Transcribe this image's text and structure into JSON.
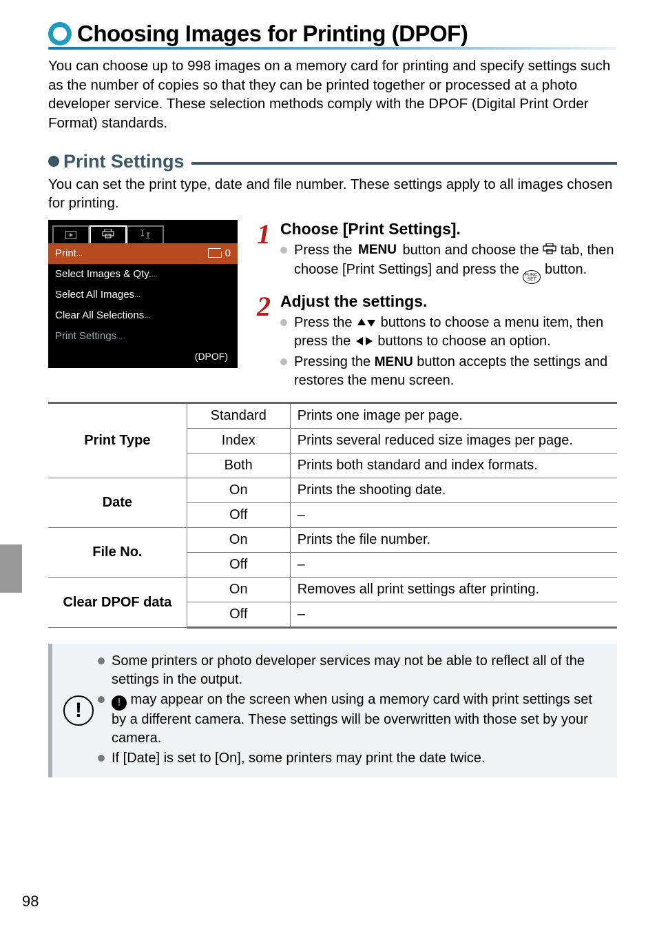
{
  "title": "Choosing Images for Printing (DPOF)",
  "intro": "You can choose up to 998 images on a memory card for printing and specify settings such as the number of copies so that they can be printed together or processed at a photo developer service. These selection methods comply with the DPOF (Digital Print Order Format) standards.",
  "section": {
    "title": "Print Settings",
    "intro": "You can set the print type, date and file number. These settings apply to all images chosen for printing."
  },
  "lcd": {
    "items": {
      "print": "Print",
      "print_count": "0",
      "select_images_qty": "Select Images & Qty.",
      "select_all": "Select All Images",
      "clear_all": "Clear All Selections",
      "print_settings": "Print Settings"
    },
    "footer": "(DPOF)"
  },
  "steps": {
    "s1": {
      "title": "Choose [Print Settings].",
      "b1a": "Press the ",
      "b1_menu": "MENU",
      "b1b": " button and choose the ",
      "b1c": " tab, then choose [Print Settings] and press the ",
      "b1_func": "FUNC. SET",
      "b1d": " button."
    },
    "s2": {
      "title": "Adjust the settings.",
      "b1a": "Press the ",
      "b1b": " buttons to choose a menu item, then press the ",
      "b1c": " buttons to choose an option.",
      "b2a": "Pressing the ",
      "b2_menu": "MENU",
      "b2b": " button accepts the settings and restores the menu screen."
    }
  },
  "table": {
    "rows": {
      "print_type": "Print Type",
      "date": "Date",
      "file_no": "File No.",
      "clear_dpof": "Clear DPOF data"
    },
    "opts": {
      "standard": "Standard",
      "index": "Index",
      "both": "Both",
      "on": "On",
      "off": "Off"
    },
    "desc": {
      "standard": "Prints one image per page.",
      "index": "Prints several reduced size images per page.",
      "both": "Prints both standard and index formats.",
      "date_on": "Prints the shooting date.",
      "dash": "–",
      "fileno_on": "Prints the file number.",
      "clear_on": "Removes all print settings after printing."
    }
  },
  "caution": {
    "b1": "Some printers or photo developer services may not be able to reflect all of the settings in the output.",
    "b2": " may appear on the screen when using a memory card with print settings set by a different camera. These settings will be overwritten with those set by your camera.",
    "b3": "If [Date] is set to [On], some printers may print the date twice."
  },
  "page_number": "98"
}
